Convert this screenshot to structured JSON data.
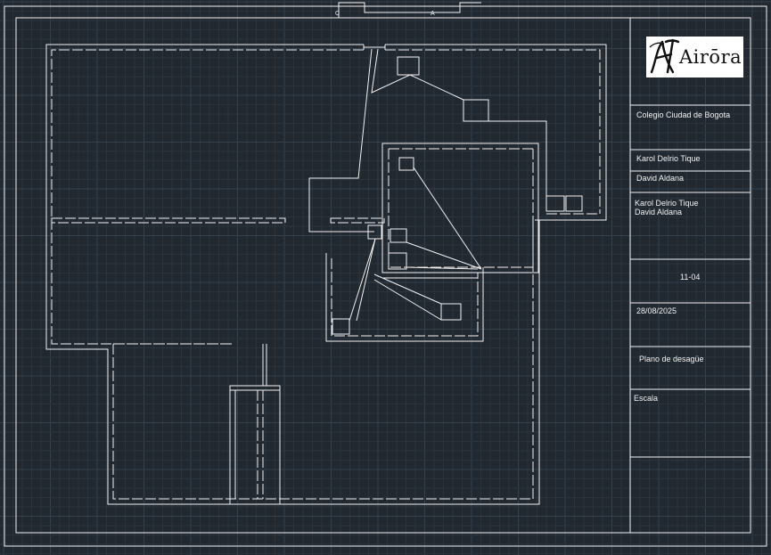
{
  "title_block": {
    "logo_text": "Airōra",
    "school": "Colegio Ciudad de Bogota",
    "author_1": "Karol Delrio Tique",
    "author_2": "David Aldana",
    "revisors_line_1": "Karol Delrio Tique",
    "revisors_line_2": "David Aldana",
    "grade": "11-04",
    "date": "28/08/2025",
    "drawing_title": "Plano de desagüe",
    "scale_label": "Escala"
  },
  "markers": {
    "left_mark": "C",
    "right_mark": "A"
  },
  "colors": {
    "background": "#212830",
    "grid_minor": "#2b333d",
    "grid_major": "#34404c",
    "line": "#f2f2f2"
  }
}
